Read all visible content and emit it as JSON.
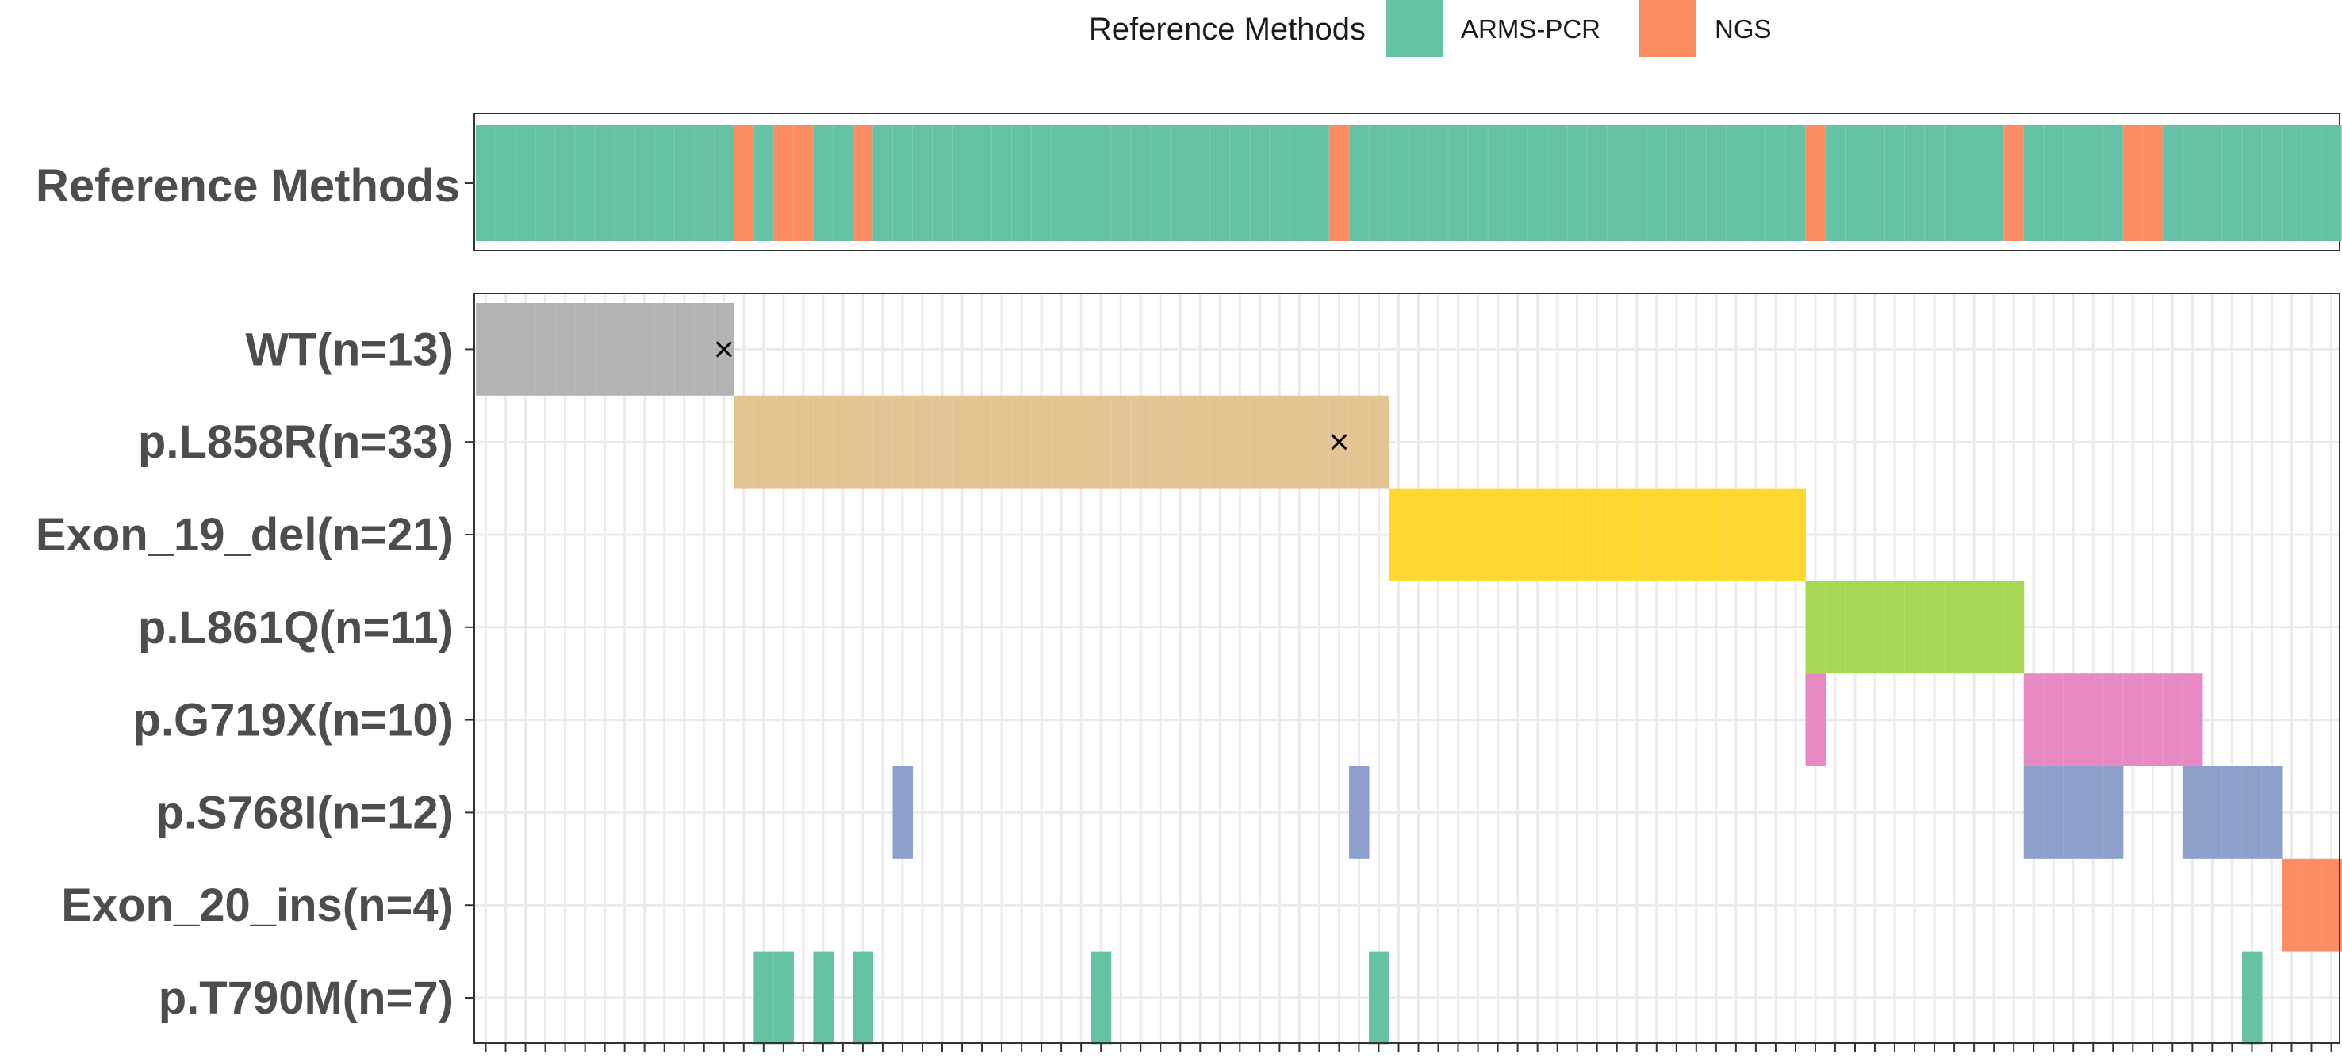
{
  "chart_data": {
    "type": "heatmap",
    "n_samples": 94,
    "legend": {
      "title": "Reference Methods",
      "items": [
        {
          "label": "ARMS-PCR",
          "color": "#66C2A5"
        },
        {
          "label": "NGS",
          "color": "#FC8D62"
        }
      ],
      "position": "top"
    },
    "reference_track": {
      "label": "Reference Methods",
      "default_method": "ARMS-PCR",
      "ngs_samples": [
        13,
        15,
        16,
        19,
        43,
        67,
        77,
        83,
        84
      ]
    },
    "mutation_rows": [
      {
        "label": "WT(n=13)",
        "color": "#B3B3B3",
        "samples": [
          0,
          1,
          2,
          3,
          4,
          5,
          6,
          7,
          8,
          9,
          10,
          11,
          12
        ],
        "x_marks": [
          12
        ]
      },
      {
        "label": "p.L858R(n=33)",
        "color": "#E5C494",
        "samples": [
          13,
          14,
          15,
          16,
          17,
          18,
          19,
          20,
          21,
          22,
          23,
          24,
          25,
          26,
          27,
          28,
          29,
          30,
          31,
          32,
          33,
          34,
          35,
          36,
          37,
          38,
          39,
          40,
          41,
          42,
          43,
          44,
          45
        ],
        "x_marks": [
          43
        ]
      },
      {
        "label": "Exon_19_del(n=21)",
        "color": "#FFD92F",
        "samples": [
          46,
          47,
          48,
          49,
          50,
          51,
          52,
          53,
          54,
          55,
          56,
          57,
          58,
          59,
          60,
          61,
          62,
          63,
          64,
          65,
          66
        ],
        "x_marks": []
      },
      {
        "label": "p.L861Q(n=11)",
        "color": "#A6D854",
        "samples": [
          67,
          68,
          69,
          70,
          71,
          72,
          73,
          74,
          75,
          76,
          77
        ],
        "x_marks": []
      },
      {
        "label": "p.G719X(n=10)",
        "color": "#E78AC3",
        "samples": [
          67,
          78,
          79,
          80,
          81,
          82,
          83,
          84,
          85,
          86
        ],
        "x_marks": []
      },
      {
        "label": "p.S768I(n=12)",
        "color": "#8DA0CB",
        "samples": [
          21,
          44,
          78,
          79,
          80,
          81,
          82,
          86,
          87,
          88,
          89,
          90
        ],
        "x_marks": []
      },
      {
        "label": "Exon_20_ins(n=4)",
        "color": "#FC8D62",
        "samples": [
          91,
          92,
          93,
          94
        ],
        "x_marks": []
      },
      {
        "label": "p.T790M(n=7)",
        "color": "#66C2A5",
        "samples": [
          14,
          15,
          17,
          19,
          31,
          45,
          89
        ],
        "x_marks": []
      }
    ],
    "grid": true
  }
}
